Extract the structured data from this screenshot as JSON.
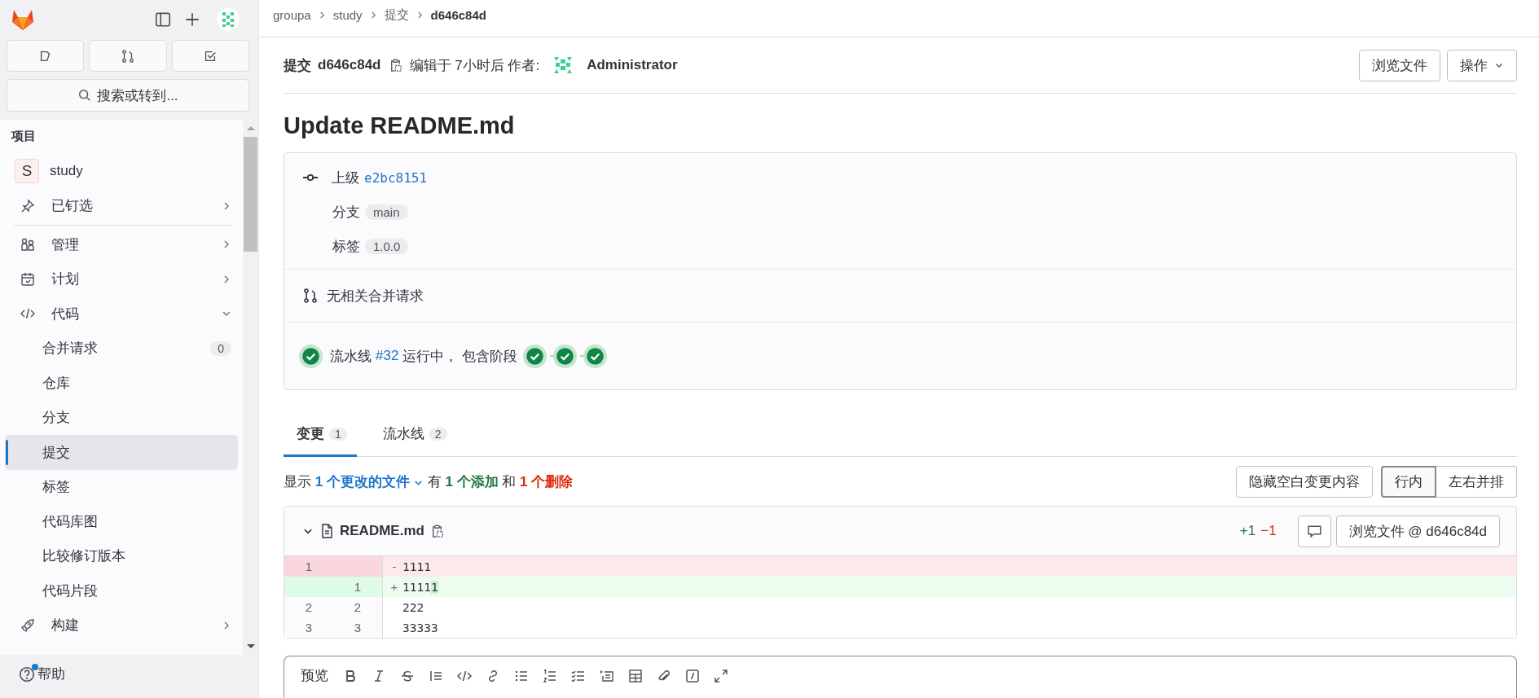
{
  "sidebar": {
    "search": {
      "placeholder": "搜索或转到..."
    },
    "section_title": "项目",
    "project": {
      "avatar": "S",
      "label": "study"
    },
    "pinned": {
      "label": "已钉选",
      "expanded": false
    },
    "menu": [
      {
        "label": "管理",
        "expanded": false
      },
      {
        "label": "计划",
        "expanded": false
      },
      {
        "label": "代码",
        "expanded": true,
        "children": [
          {
            "label": "合并请求",
            "badge": "0",
            "selected": false
          },
          {
            "label": "仓库",
            "selected": false
          },
          {
            "label": "分支",
            "selected": false
          },
          {
            "label": "提交",
            "selected": true
          },
          {
            "label": "标签",
            "selected": false
          },
          {
            "label": "代码库图",
            "selected": false
          },
          {
            "label": "比较修订版本",
            "selected": false
          },
          {
            "label": "代码片段",
            "selected": false
          }
        ]
      },
      {
        "label": "构建",
        "expanded": false
      }
    ],
    "help": {
      "label": "帮助",
      "notification": true
    }
  },
  "breadcrumb": [
    "groupa",
    "study",
    "提交",
    "d646c84d"
  ],
  "commit_header": {
    "label": "提交",
    "sha": "d646c84d",
    "meta": "编辑于 7小时后 作者:",
    "author": "Administrator",
    "browse_button": "浏览文件",
    "actions_button": "操作"
  },
  "title": "Update README.md",
  "info": {
    "parent_label": "上级",
    "parent_sha": "e2bc8151",
    "branch_label": "分支",
    "branch": "main",
    "tag_label": "标签",
    "tag": "1.0.0",
    "merge_requests": "无相关合并请求",
    "pipeline": {
      "kind": "success",
      "prefix": "流水线",
      "link": "#32",
      "suffix": "运行中， 包含阶段",
      "stages": [
        {
          "kind": "success"
        },
        {
          "kind": "success"
        },
        {
          "kind": "success"
        }
      ]
    }
  },
  "tabs": [
    {
      "label": "变更",
      "count": "1",
      "selected": true
    },
    {
      "label": "流水线",
      "count": "2",
      "selected": false
    }
  ],
  "summary": {
    "show": "显示",
    "files_link": "1 个更改的文件",
    "has": "有",
    "added": "1 个添加",
    "and": "和",
    "deleted": "1 个删除"
  },
  "whitespace_button": "隐藏空白变更内容",
  "view_toggle": [
    {
      "label": "行内",
      "selected": true
    },
    {
      "label": "左右并排",
      "selected": false
    }
  ],
  "file": {
    "name": "README.md",
    "expanded": true,
    "added": "+1",
    "removed": "−1",
    "browse_button": "浏览文件 @ d646c84d",
    "lines": [
      {
        "kind": "removed",
        "old": "1",
        "sign": "-",
        "text": "1111"
      },
      {
        "kind": "added",
        "new": "1",
        "sign": "+",
        "text": "1111",
        "highlight": "1"
      },
      {
        "kind": "context",
        "old": "2",
        "new": "2",
        "text": "222"
      },
      {
        "kind": "context",
        "old": "3",
        "new": "3",
        "text": "33333"
      }
    ]
  },
  "editor": {
    "preview_tab": "预览"
  }
}
